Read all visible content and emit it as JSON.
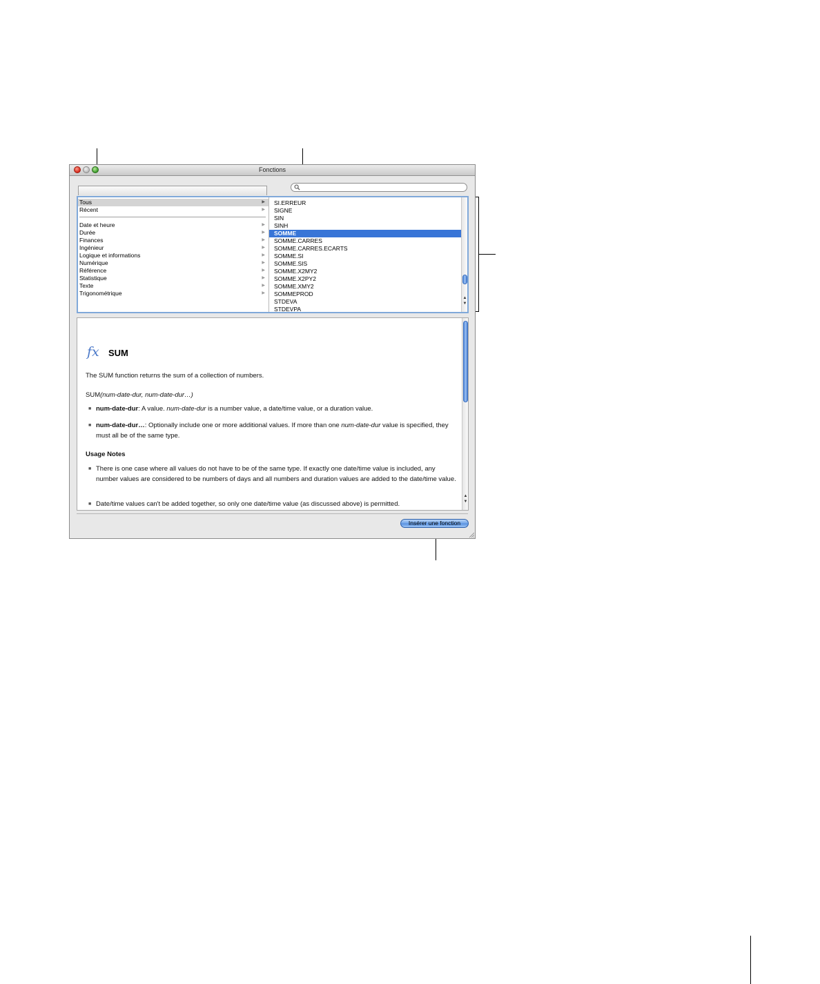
{
  "window": {
    "title": "Fonctions"
  },
  "search": {
    "placeholder": ""
  },
  "categories": [
    {
      "label": "Tous",
      "selected": true
    },
    {
      "label": "Récent",
      "selected": false
    },
    {
      "label": "Date et heure",
      "selected": false
    },
    {
      "label": "Durée",
      "selected": false
    },
    {
      "label": "Finances",
      "selected": false
    },
    {
      "label": "Ingénieur",
      "selected": false
    },
    {
      "label": "Logique et informations",
      "selected": false
    },
    {
      "label": "Numérique",
      "selected": false
    },
    {
      "label": "Référence",
      "selected": false
    },
    {
      "label": "Statistique",
      "selected": false
    },
    {
      "label": "Texte",
      "selected": false
    },
    {
      "label": "Trigonométrique",
      "selected": false
    }
  ],
  "functions": [
    {
      "label": "SI.ERREUR",
      "selected": false
    },
    {
      "label": "SIGNE",
      "selected": false
    },
    {
      "label": "SIN",
      "selected": false
    },
    {
      "label": "SINH",
      "selected": false
    },
    {
      "label": "SOMME",
      "selected": true
    },
    {
      "label": "SOMME.CARRES",
      "selected": false
    },
    {
      "label": "SOMME.CARRES.ECARTS",
      "selected": false
    },
    {
      "label": "SOMME.SI",
      "selected": false
    },
    {
      "label": "SOMME.SIS",
      "selected": false
    },
    {
      "label": "SOMME.X2MY2",
      "selected": false
    },
    {
      "label": "SOMME.X2PY2",
      "selected": false
    },
    {
      "label": "SOMME.XMY2",
      "selected": false
    },
    {
      "label": "SOMMEPROD",
      "selected": false
    },
    {
      "label": "STDEVA",
      "selected": false
    },
    {
      "label": "STDEVPA",
      "selected": false
    }
  ],
  "description": {
    "fx_symbol": "fx",
    "name": "SUM",
    "summary": "The SUM function returns the sum of a collection of numbers.",
    "syntax_name": "SUM",
    "syntax_args": "(num-date-dur, num-date-dur…)",
    "arg1_name": "num-date-dur",
    "arg1_text_a": ":  A value. ",
    "arg1_italic": "num-date-dur",
    "arg1_text_b": " is a number value, a date/time value, or a duration value.",
    "arg2_name": "num-date-dur…",
    "arg2_text_a": ":  Optionally include one or more additional values. If more than one ",
    "arg2_italic": "num-date-dur",
    "arg2_text_b": " value is specified, they must all be of the same type.",
    "usage_heading": "Usage Notes",
    "note1": "There is one case where all values do not have to be of the same type. If exactly one date/time value is included, any number values are considered to be numbers of days and all numbers and duration values are added to the date/time value.",
    "note2": "Date/time values can't be added together, so only one date/time value (as discussed above) is permitted."
  },
  "insert_button": {
    "label": "Insérer une fonction"
  },
  "scroll": {
    "function_list_position": 0.76,
    "description_position": 0.0
  },
  "colors": {
    "selection": "#3875d7",
    "focus_ring": "#7fa8d9",
    "fx_icon": "#4a78c8"
  }
}
